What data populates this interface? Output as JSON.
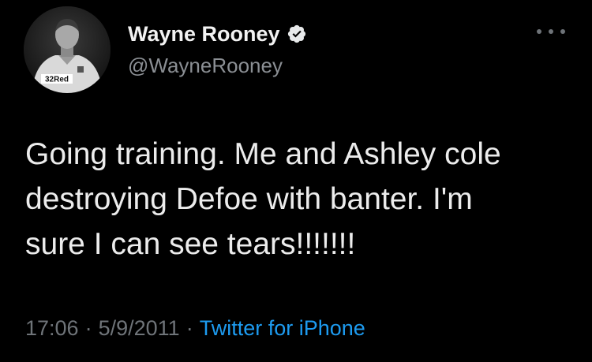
{
  "user": {
    "display_name": "Wayne Rooney",
    "handle": "@WayneRooney",
    "verified": true,
    "avatar_sponsor_text": "32Red"
  },
  "tweet": {
    "lines": [
      "Going training. Me and Ashley cole",
      "destroying Defoe with banter. I'm",
      "sure I can see tears!!!!!!!"
    ],
    "time": "17:06",
    "date": "5/9/2011",
    "separator": "·",
    "source": "Twitter for iPhone"
  },
  "icons": {
    "verified": "verified-badge-icon",
    "more": "more-options-icon"
  },
  "colors": {
    "background": "#000000",
    "text": "#e7e9ea",
    "secondary_text": "#6f7479",
    "link": "#1d9bf0"
  }
}
